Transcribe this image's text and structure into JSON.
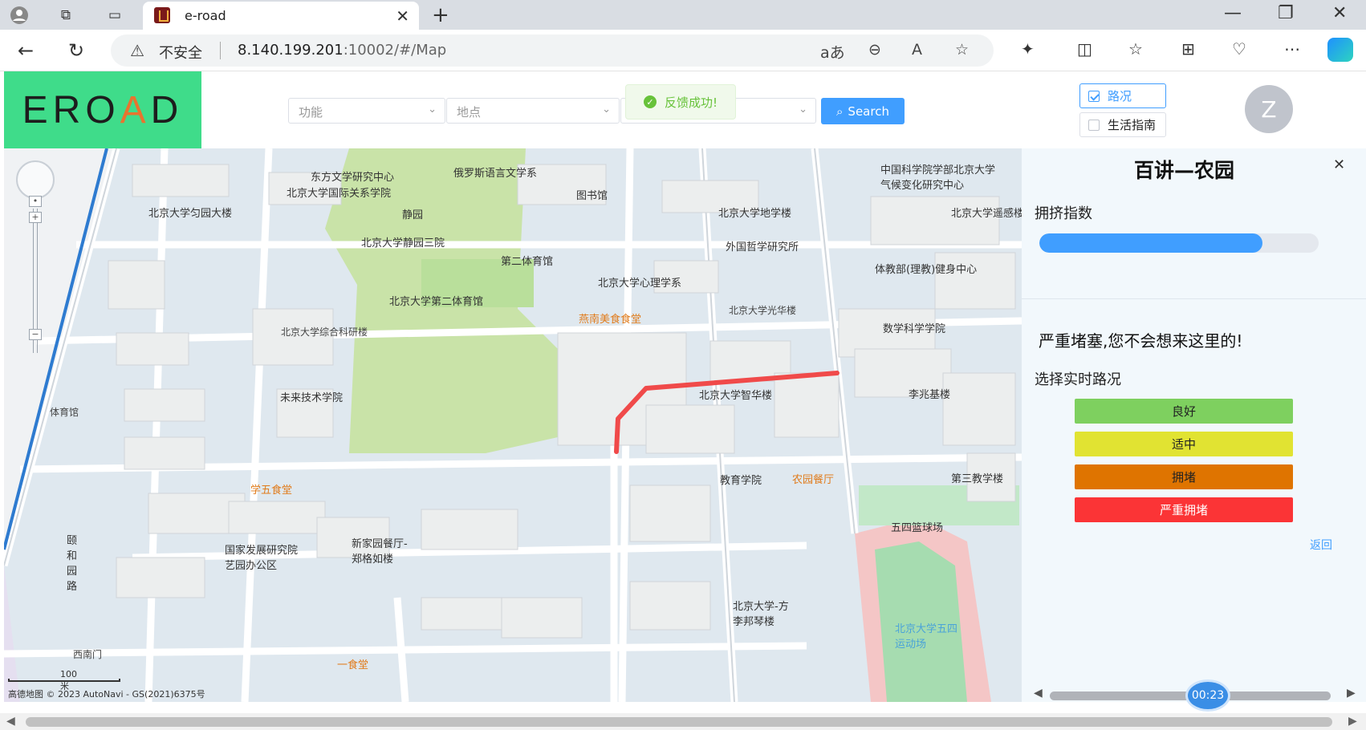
{
  "browser": {
    "tab_title": "e-road",
    "security_label": "不安全",
    "url_host": "8.140.199.201",
    "url_rest": ":10002/#/Map"
  },
  "header": {
    "logo_text": "EROAD",
    "select_function_placeholder": "功能",
    "select_place_placeholder": "地点",
    "toast_text": "反馈成功!",
    "search_label": "Search",
    "checkbox_traffic": "路况",
    "checkbox_guide": "生活指南",
    "avatar_letter": "Z"
  },
  "map": {
    "labels": [
      "北京大学国际关系学院",
      "东方文学研究中心",
      "俄罗斯语言文学系",
      "图书馆",
      "北京大学地学楼",
      "中国科学院学部北京大学气候变化研究中心",
      "北京大学匀园大楼",
      "静园",
      "北京大学静园三院",
      "外国哲学研究所",
      "北京大学遥感楼",
      "第二体育馆",
      "北京大学心理学系",
      "体教部(理教)健身中心",
      "北京大学第二体育馆",
      "燕南美食食堂",
      "北京大学光华楼",
      "数学科学学院",
      "北京大学综合科研楼",
      "未来技术学院",
      "北京大学智华楼",
      "李兆基楼",
      "学五食堂",
      "教育学院",
      "农园餐厅",
      "第三教学楼",
      "国家发展研究院艺园办公区",
      "新家园餐厅-郑格如楼",
      "五四篮球场",
      "北京大学-方李邦琴楼",
      "北京大学五四运动场",
      "一食堂",
      "西南门",
      "体育馆",
      "颐和园路"
    ],
    "scale_text": "100 米",
    "attribution": "高德地图  © 2023 AutoNavi - GS(2021)6375号",
    "route_color": "#f04a4a"
  },
  "panel": {
    "title": "百讲—农园",
    "congestion_label": "拥挤指数",
    "congestion_fraction": 0.8,
    "message": "严重堵塞,您不会想来这里的!",
    "select_label": "选择实时路况",
    "buttons": [
      {
        "label": "良好",
        "color": "#7ed05f"
      },
      {
        "label": "适中",
        "color": "#e1e332"
      },
      {
        "label": "拥堵",
        "color": "#df7400"
      },
      {
        "label": "严重拥堵",
        "color": "#fb3436"
      }
    ],
    "back_label": "返回"
  },
  "player": {
    "time": "00:23"
  }
}
